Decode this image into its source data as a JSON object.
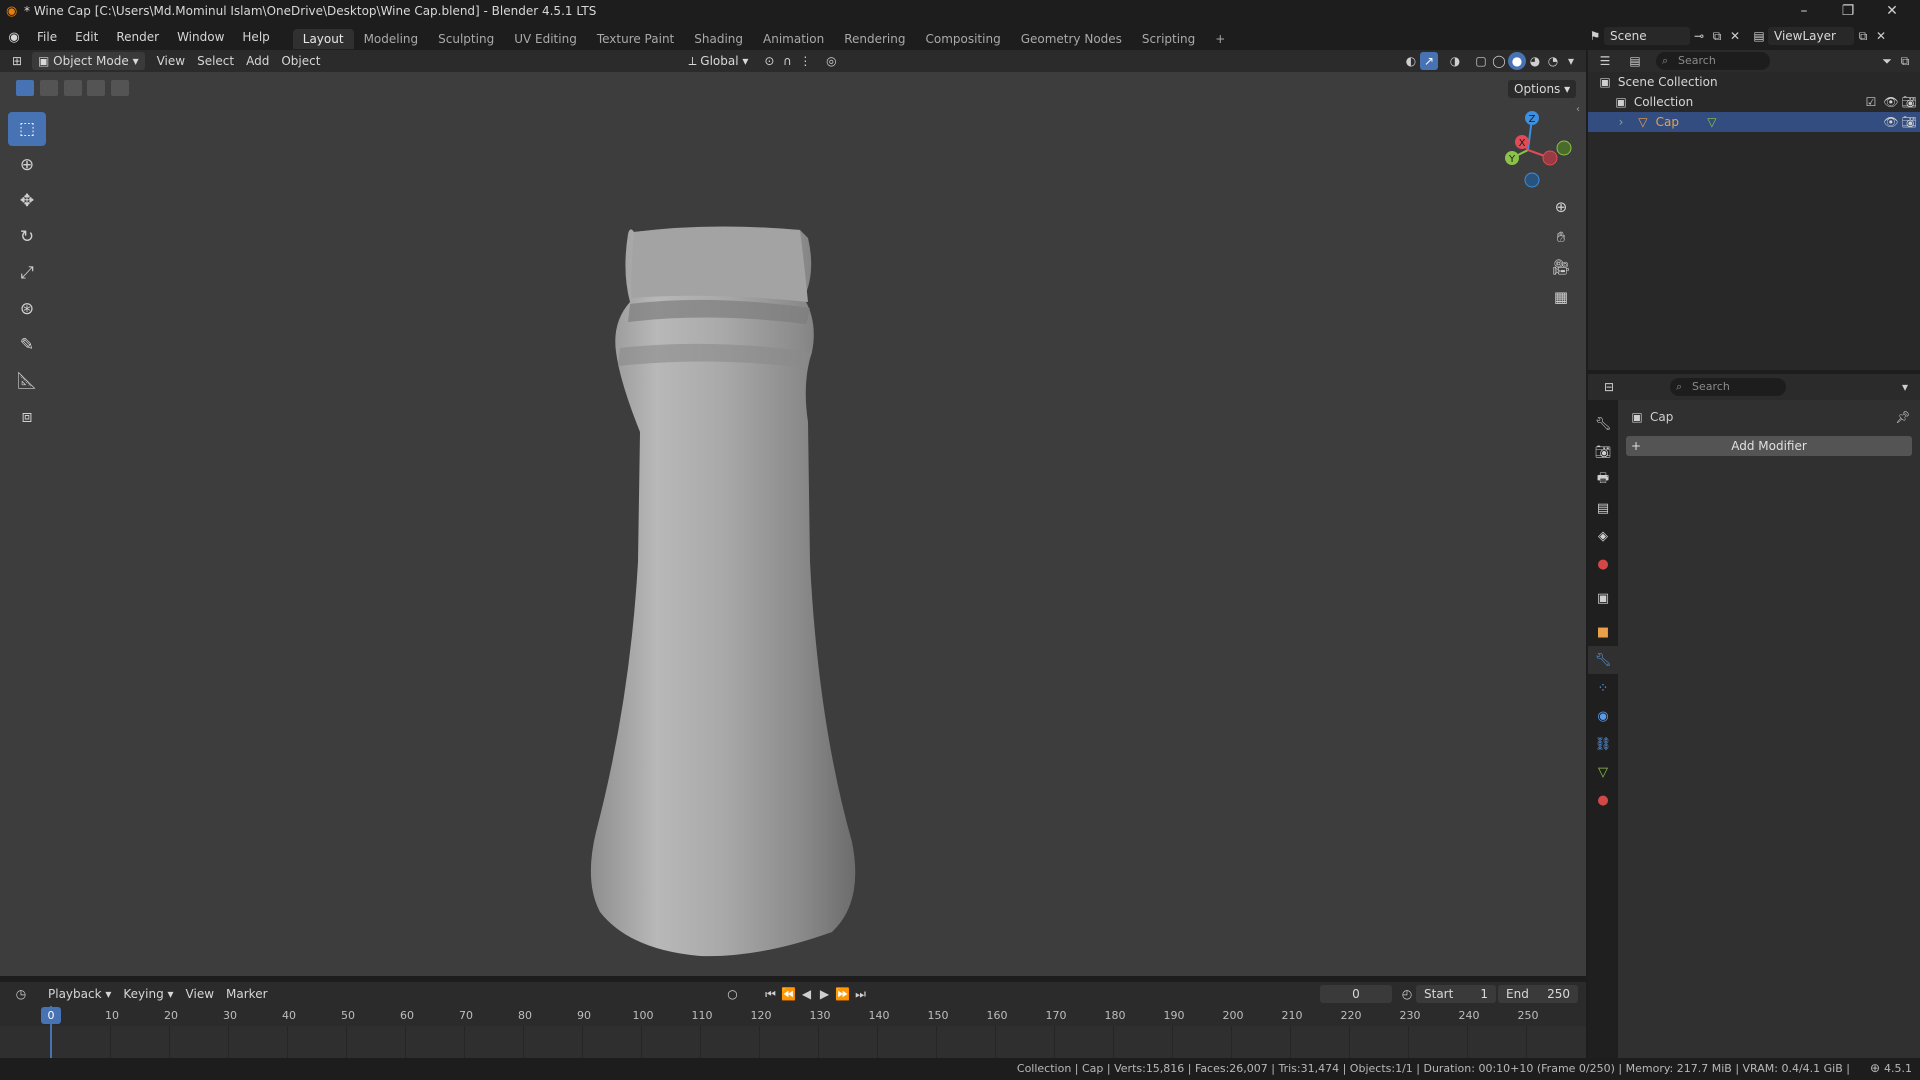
{
  "window": {
    "title": "* Wine Cap [C:\\Users\\Md.Mominul Islam\\OneDrive\\Desktop\\Wine Cap.blend] - Blender 4.5.1 LTS",
    "minimize": "–",
    "maximize": "❐",
    "close": "✕"
  },
  "menus": [
    "File",
    "Edit",
    "Render",
    "Window",
    "Help"
  ],
  "workspaces": [
    "Layout",
    "Modeling",
    "Sculpting",
    "UV Editing",
    "Texture Paint",
    "Shading",
    "Animation",
    "Rendering",
    "Compositing",
    "Geometry Nodes",
    "Scripting"
  ],
  "active_workspace": "Layout",
  "add_workspace": "+",
  "scene": {
    "label": "Scene",
    "view_layer": "ViewLayer"
  },
  "viewport_header": {
    "mode": "Object Mode",
    "menus": [
      "View",
      "Select",
      "Add",
      "Object"
    ],
    "orientation": "Global",
    "options": "Options"
  },
  "gizmo": {
    "x": "X",
    "y": "Y",
    "z": "Z"
  },
  "outliner": {
    "search_placeholder": "Search",
    "scene_collection": "Scene Collection",
    "collection": "Collection",
    "object": "Cap"
  },
  "properties": {
    "search_placeholder": "Search",
    "object_name": "Cap",
    "add_modifier": "Add Modifier"
  },
  "timeline": {
    "menus": [
      "Playback",
      "Keying",
      "View",
      "Marker"
    ],
    "current_frame": "0",
    "start_label": "Start",
    "start": "1",
    "end_label": "End",
    "end": "250",
    "ticks": [
      "0",
      "10",
      "20",
      "30",
      "40",
      "50",
      "60",
      "70",
      "80",
      "90",
      "100",
      "110",
      "120",
      "130",
      "140",
      "150",
      "160",
      "170",
      "180",
      "190",
      "200",
      "210",
      "220",
      "230",
      "240",
      "250"
    ]
  },
  "status": {
    "text": "Collection | Cap | Verts:15,816 | Faces:26,007 | Tris:31,474 | Objects:1/1 | Duration: 00:10+10 (Frame 0/250) | Memory: 217.7 MiB | VRAM: 0.4/4.1 GiB |",
    "version": "4.5.1"
  },
  "colors": {
    "accent": "#4772b3",
    "selection_row": "#334d80",
    "viewport_bg": "#3d3d3d",
    "axis_x": "#e04b57",
    "axis_y": "#8bc34a",
    "axis_z": "#3d8fe0"
  }
}
